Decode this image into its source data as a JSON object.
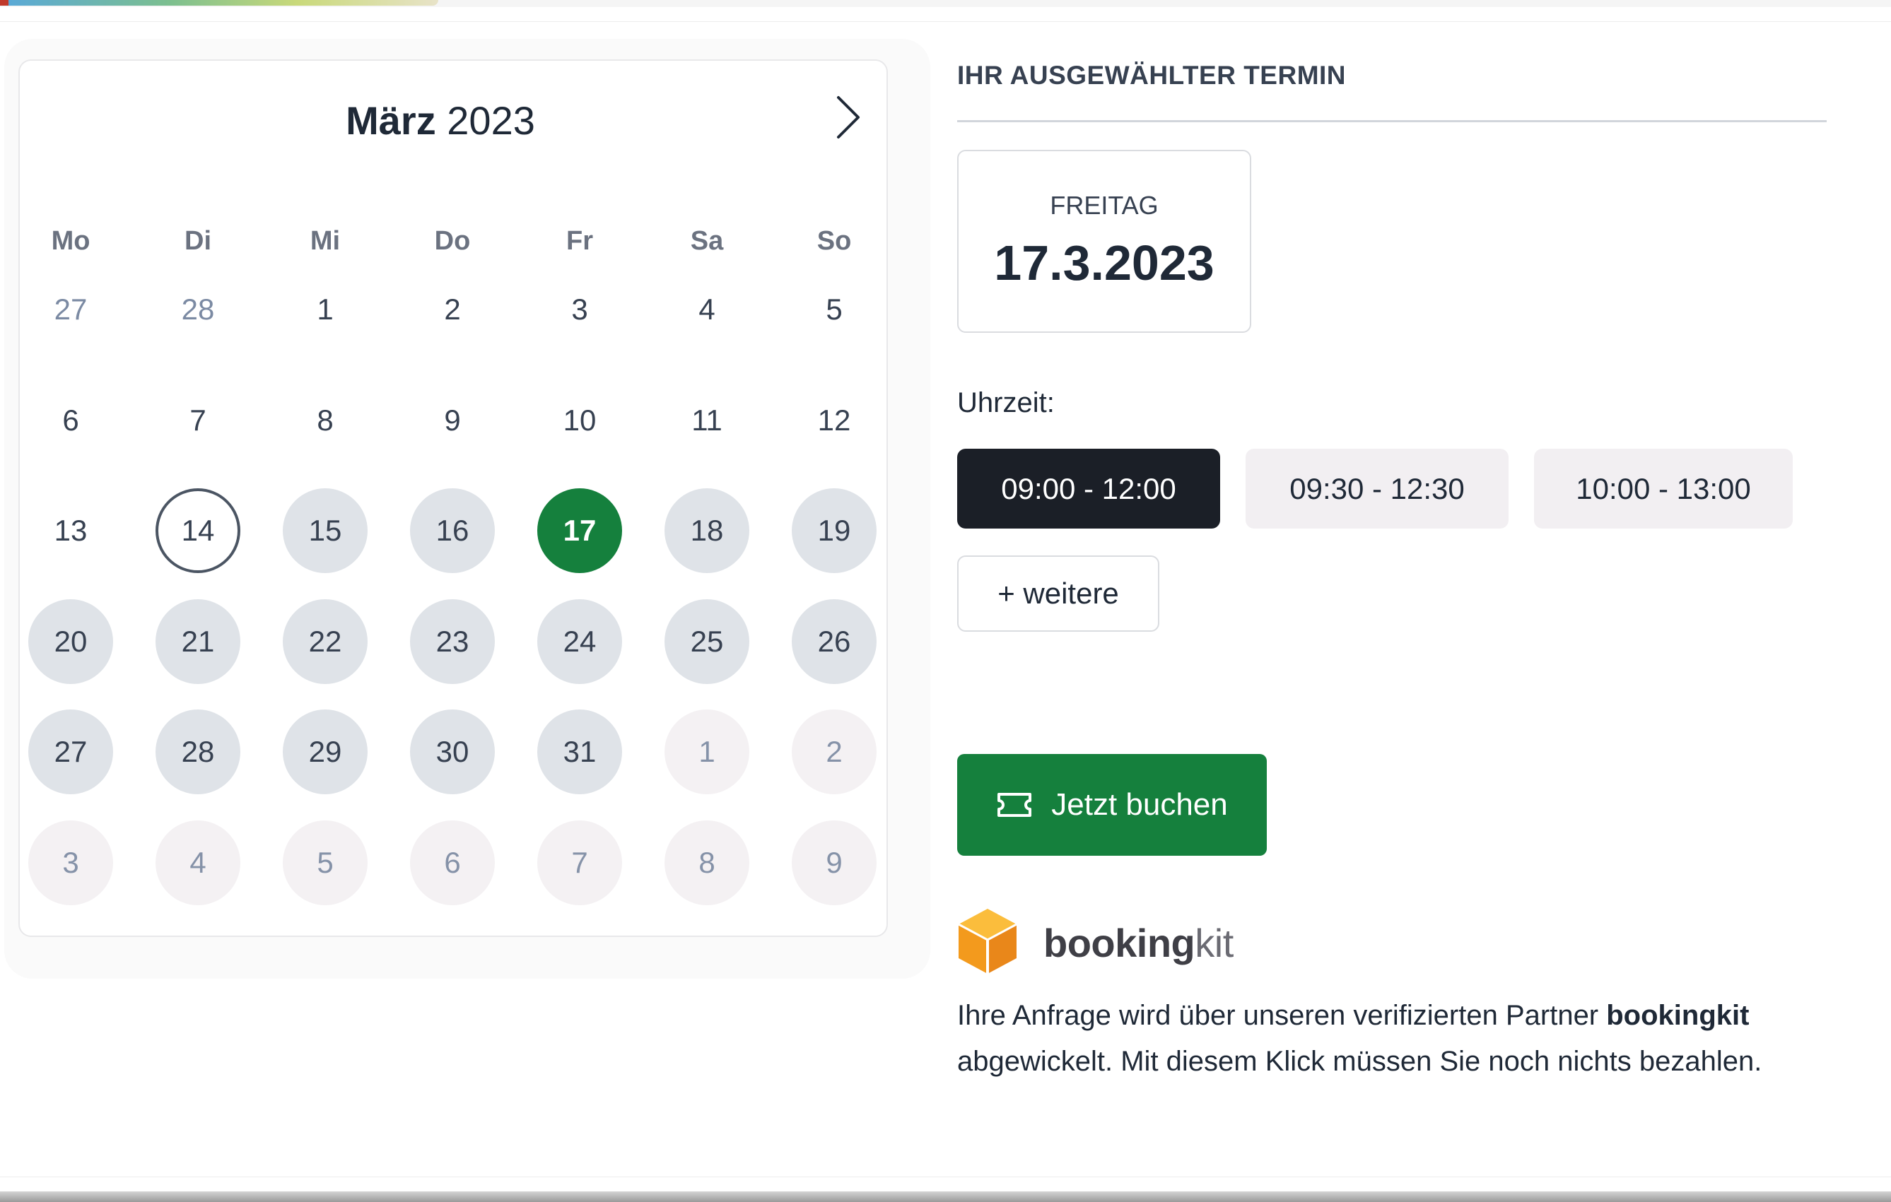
{
  "calendar": {
    "month": "März",
    "year": "2023",
    "weekdays": [
      "Mo",
      "Di",
      "Mi",
      "Do",
      "Fr",
      "Sa",
      "So"
    ],
    "weeks": [
      [
        {
          "d": "27",
          "s": "other"
        },
        {
          "d": "28",
          "s": "other"
        },
        {
          "d": "1",
          "s": "plain"
        },
        {
          "d": "2",
          "s": "plain"
        },
        {
          "d": "3",
          "s": "plain"
        },
        {
          "d": "4",
          "s": "plain"
        },
        {
          "d": "5",
          "s": "plain"
        }
      ],
      [
        {
          "d": "6",
          "s": "plain"
        },
        {
          "d": "7",
          "s": "plain"
        },
        {
          "d": "8",
          "s": "plain"
        },
        {
          "d": "9",
          "s": "plain"
        },
        {
          "d": "10",
          "s": "plain"
        },
        {
          "d": "11",
          "s": "plain"
        },
        {
          "d": "12",
          "s": "plain"
        }
      ],
      [
        {
          "d": "13",
          "s": "plain"
        },
        {
          "d": "14",
          "s": "today"
        },
        {
          "d": "15",
          "s": "avail"
        },
        {
          "d": "16",
          "s": "avail"
        },
        {
          "d": "17",
          "s": "selected"
        },
        {
          "d": "18",
          "s": "avail"
        },
        {
          "d": "19",
          "s": "avail"
        }
      ],
      [
        {
          "d": "20",
          "s": "avail"
        },
        {
          "d": "21",
          "s": "avail"
        },
        {
          "d": "22",
          "s": "avail"
        },
        {
          "d": "23",
          "s": "avail"
        },
        {
          "d": "24",
          "s": "avail"
        },
        {
          "d": "25",
          "s": "avail"
        },
        {
          "d": "26",
          "s": "avail"
        }
      ],
      [
        {
          "d": "27",
          "s": "avail"
        },
        {
          "d": "28",
          "s": "avail"
        },
        {
          "d": "29",
          "s": "avail"
        },
        {
          "d": "30",
          "s": "avail"
        },
        {
          "d": "31",
          "s": "avail"
        },
        {
          "d": "1",
          "s": "faded"
        },
        {
          "d": "2",
          "s": "faded"
        }
      ],
      [
        {
          "d": "3",
          "s": "faded"
        },
        {
          "d": "4",
          "s": "faded"
        },
        {
          "d": "5",
          "s": "faded"
        },
        {
          "d": "6",
          "s": "faded"
        },
        {
          "d": "7",
          "s": "faded"
        },
        {
          "d": "8",
          "s": "faded"
        },
        {
          "d": "9",
          "s": "faded"
        }
      ]
    ],
    "next_icon": "chevron-right-icon"
  },
  "selection": {
    "title": "IHR AUSGEWÄHLTER TERMIN",
    "weekday": "FREITAG",
    "date": "17.3.2023",
    "time_label": "Uhrzeit:",
    "slots": [
      "09:00 - 12:00",
      "09:30 - 12:30",
      "10:00 - 13:00"
    ],
    "active_slot": 0,
    "more_label": "+ weitere",
    "book_label": "Jetzt buchen",
    "book_icon": "ticket-icon"
  },
  "partner": {
    "logo_bold": "booking",
    "logo_light": "kit",
    "info_prefix": "Ihre Anfrage wird über unseren verifizierten Partner ",
    "info_bold": "bookingkit",
    "info_suffix": " abgewickelt. Mit diesem Klick müssen Sie noch nichts bezahlen."
  },
  "colors": {
    "selected_day": "#15803d",
    "book_button": "#15803d",
    "active_slot": "#1b1f27",
    "logo_orange": "#f6a623"
  }
}
